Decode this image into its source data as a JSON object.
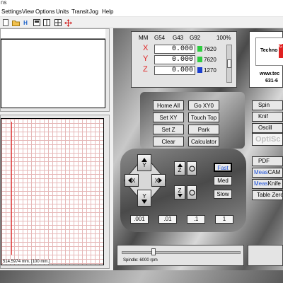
{
  "title_fragment": "ns",
  "menu": [
    "Settings",
    "View",
    "Options",
    "Units",
    "Transit",
    "Jog",
    "Help"
  ],
  "dro": {
    "headers": {
      "mm": "MM",
      "g54": "G54",
      "g43": "G43",
      "g92": "G92",
      "pct": "100%"
    },
    "axes": [
      {
        "label": "X",
        "value": "0.000",
        "rpm": "7620",
        "color": "#2ecc40"
      },
      {
        "label": "Y",
        "value": "0.000",
        "rpm": "7620",
        "color": "#2ecc40"
      },
      {
        "label": "Z",
        "value": "0.000",
        "rpm": "1270",
        "color": "#1a3fcf"
      }
    ]
  },
  "logo": {
    "name": "Techno",
    "badge": "C",
    "url": "www.tec",
    "phone": "631-6"
  },
  "controls": {
    "home_all": "Home All",
    "go_xy0": "Go XY0",
    "set_xy": "Set XY",
    "touch_top": "Touch Top",
    "set_z": "Set Z",
    "park": "Park",
    "clear": "Clear",
    "calculator": "Calculator"
  },
  "jog": {
    "y_plus": "Y",
    "y_minus": "Y",
    "x_minus": "X",
    "x_plus": "X",
    "z_plus": "Z",
    "z_minus": "Z",
    "fast": "Fast",
    "med": "Med",
    "slow": "Slow",
    "steps": [
      ".001",
      ".01",
      ".1",
      "1"
    ]
  },
  "side_buttons": {
    "spindle": "Spin",
    "knife": "Knif",
    "oscillate": "Oscill",
    "optiscout": "OptiSc",
    "pdf": "PDF",
    "meas_cam_a": "Meas",
    "meas_cam_b": "CAM",
    "meas_knife_a": "Meas",
    "meas_knife_b": "Knife",
    "table_zero": "Table Zero"
  },
  "spindle": {
    "label": "Spindle: 6000 rpm",
    "fraction": 0.25
  },
  "grid_status": "514.5974 mm. [100 mm.]"
}
